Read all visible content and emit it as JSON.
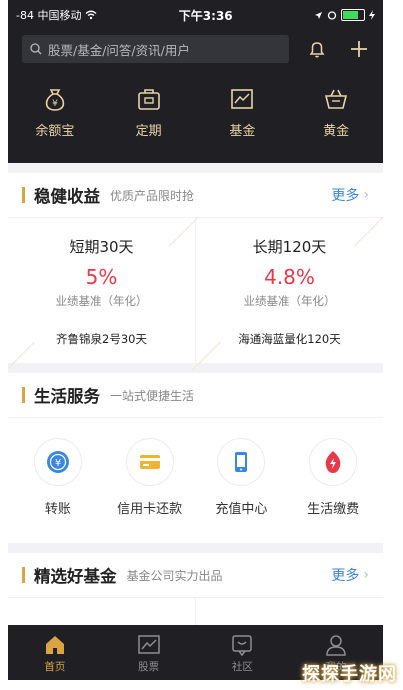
{
  "status": {
    "carrier": "-84 中国移动",
    "time": "下午3:36"
  },
  "search": {
    "placeholder": "股票/基金/问答/资讯/用户"
  },
  "quick_actions": [
    {
      "label": "余额宝",
      "icon": "money-bag-icon"
    },
    {
      "label": "定期",
      "icon": "safe-icon"
    },
    {
      "label": "基金",
      "icon": "chart-icon"
    },
    {
      "label": "黄金",
      "icon": "basket-icon"
    }
  ],
  "steady": {
    "title": "稳健收益",
    "subtitle": "优质产品限时抢",
    "more": "更多",
    "products": [
      {
        "name": "短期30天",
        "rate": "5%",
        "benchmark": "业绩基准（年化）",
        "fund": "齐鲁锦泉2号30天"
      },
      {
        "name": "长期120天",
        "rate": "4.8%",
        "benchmark": "业绩基准（年化）",
        "fund": "海通海蓝量化120天"
      }
    ]
  },
  "services": {
    "title": "生活服务",
    "subtitle": "一站式便捷生活",
    "items": [
      {
        "label": "转账",
        "icon": "transfer-icon",
        "color": "#3a86e0"
      },
      {
        "label": "信用卡还款",
        "icon": "credit-card-icon",
        "color": "#f2b233"
      },
      {
        "label": "充值中心",
        "icon": "phone-icon",
        "color": "#3a86e0"
      },
      {
        "label": "生活缴费",
        "icon": "bolt-icon",
        "color": "#e8394a"
      }
    ]
  },
  "funds": {
    "title": "精选好基金",
    "subtitle": "基金公司实力出品",
    "more": "更多"
  },
  "tabs": [
    {
      "label": "首页",
      "icon": "home-icon",
      "active": true
    },
    {
      "label": "股票",
      "icon": "stock-chart-icon",
      "active": false
    },
    {
      "label": "社区",
      "icon": "community-icon",
      "active": false
    },
    {
      "label": "我的",
      "icon": "user-icon",
      "active": false
    }
  ],
  "watermark": "探探手游网",
  "colors": {
    "header_bg": "#1f1f24",
    "gold": "#e7d3a5",
    "accent": "#d9a441",
    "rate_red": "#e8394a",
    "link_blue": "#3a86e0"
  }
}
